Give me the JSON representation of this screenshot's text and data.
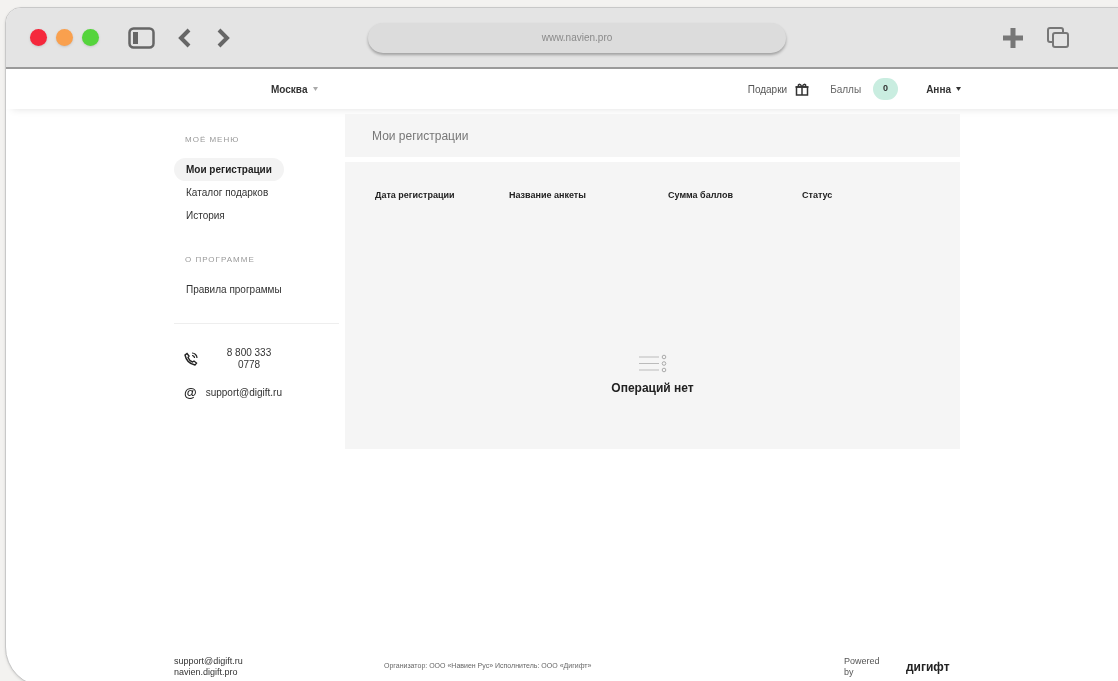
{
  "browser": {
    "url": "www.navien.pro"
  },
  "header": {
    "city": "Москва",
    "gifts": "Подарки",
    "points_label": "Баллы",
    "points": "0",
    "user": "Анна"
  },
  "sidebar": {
    "sections": [
      {
        "title": "МОЁ МЕНЮ",
        "items": [
          {
            "label": "Мои регистрации",
            "selected": true
          },
          {
            "label": "Каталог подарков",
            "selected": false
          },
          {
            "label": "История",
            "selected": false
          }
        ]
      },
      {
        "title": "О ПРОГРАММЕ",
        "items": [
          {
            "label": "Правила программы",
            "selected": false
          }
        ]
      }
    ],
    "phone": "8 800 333 0778",
    "email_icon": "@",
    "email": "support@digift.ru"
  },
  "main": {
    "title": "Мои регистрации",
    "columns": [
      "Дата регистрации",
      "Название анкеты",
      "Сумма баллов",
      "Статус"
    ],
    "empty_text": "Операций нет"
  },
  "footer": {
    "email": "support@digift.ru",
    "site": "navien.digift.pro",
    "legal": "Организатор: ООО «Навиен Рус» Исполнитель: ООО «Дигифт»",
    "powered": "Powered by",
    "logo": "дигифт"
  }
}
